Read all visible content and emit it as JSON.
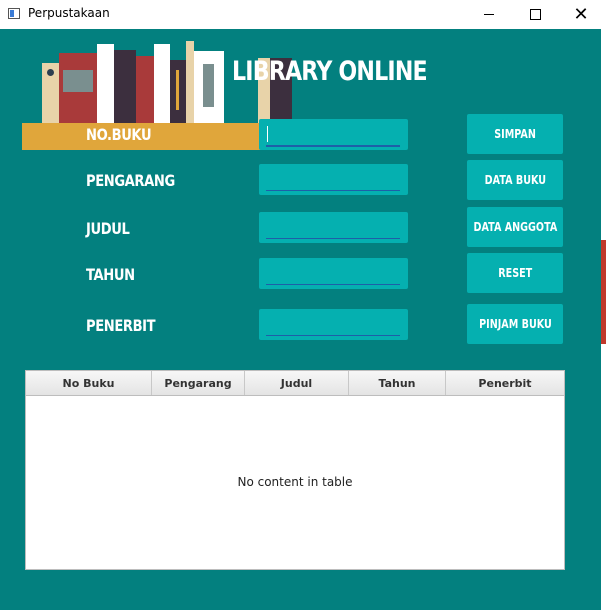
{
  "window": {
    "title": "Perpustakaan",
    "controls": [
      "minimize",
      "maximize",
      "close"
    ],
    "close_glyph": "✕"
  },
  "header": {
    "title": "LIBRARY ONLINE",
    "illustration": "bookshelf-illustration"
  },
  "form": {
    "fields": [
      {
        "label": "NO.BUKU",
        "value": "",
        "focused": true
      },
      {
        "label": "PENGARANG",
        "value": ""
      },
      {
        "label": "JUDUL",
        "value": ""
      },
      {
        "label": "TAHUN",
        "value": ""
      },
      {
        "label": "PENERBIT",
        "value": ""
      }
    ]
  },
  "actions": {
    "simpan": "SIMPAN",
    "data_buku": "DATA BUKU",
    "data_anggota": "DATA ANGGOTA",
    "reset": "RESET",
    "pinjam_buku": "PINJAM BUKU"
  },
  "table": {
    "columns": [
      "No Buku",
      "Pengarang",
      "Judul",
      "Tahun",
      "Penerbit"
    ],
    "rows": [],
    "empty_text": "No content in table"
  },
  "colors": {
    "background": "#03807f",
    "field": "#05b0b0",
    "button": "#05b0b0",
    "text": "#ffffff"
  }
}
